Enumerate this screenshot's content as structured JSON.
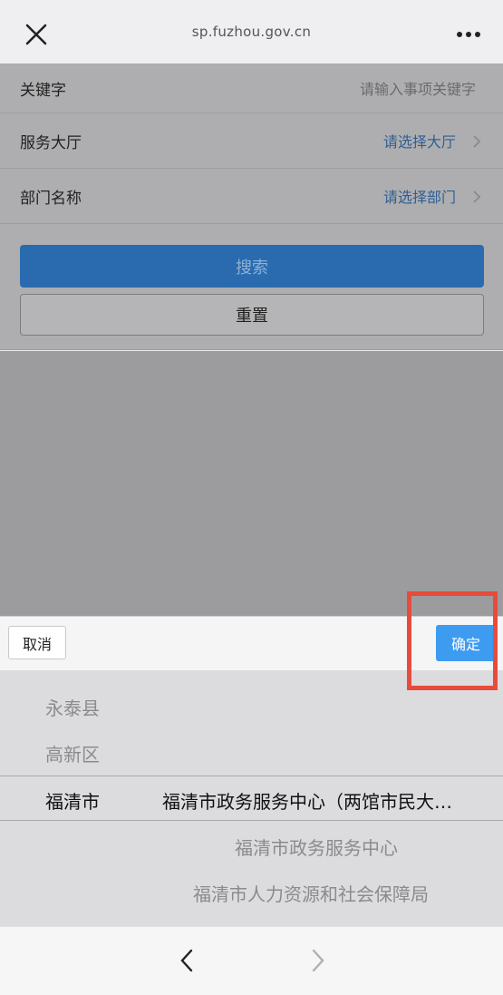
{
  "browser": {
    "url": "sp.fuzhou.gov.cn"
  },
  "form": {
    "keyword": {
      "label": "关键字",
      "placeholder": "请输入事项关键字"
    },
    "hall": {
      "label": "服务大厅",
      "value": "请选择大厅"
    },
    "department": {
      "label": "部门名称",
      "value": "请选择部门"
    },
    "search_label": "搜索",
    "reset_label": "重置"
  },
  "picker": {
    "cancel_label": "取消",
    "confirm_label": "确定",
    "left_items": [
      "永泰县",
      "高新区",
      "福清市"
    ],
    "right_selected": "福清市政务服务中心（两馆市民大…",
    "right_items": [
      "福清市政务服务中心",
      "福清市人力资源和社会保障局"
    ]
  },
  "colors": {
    "accent": "#3d9bf0",
    "highlight": "#e84b3c",
    "link": "#2d5f94"
  }
}
